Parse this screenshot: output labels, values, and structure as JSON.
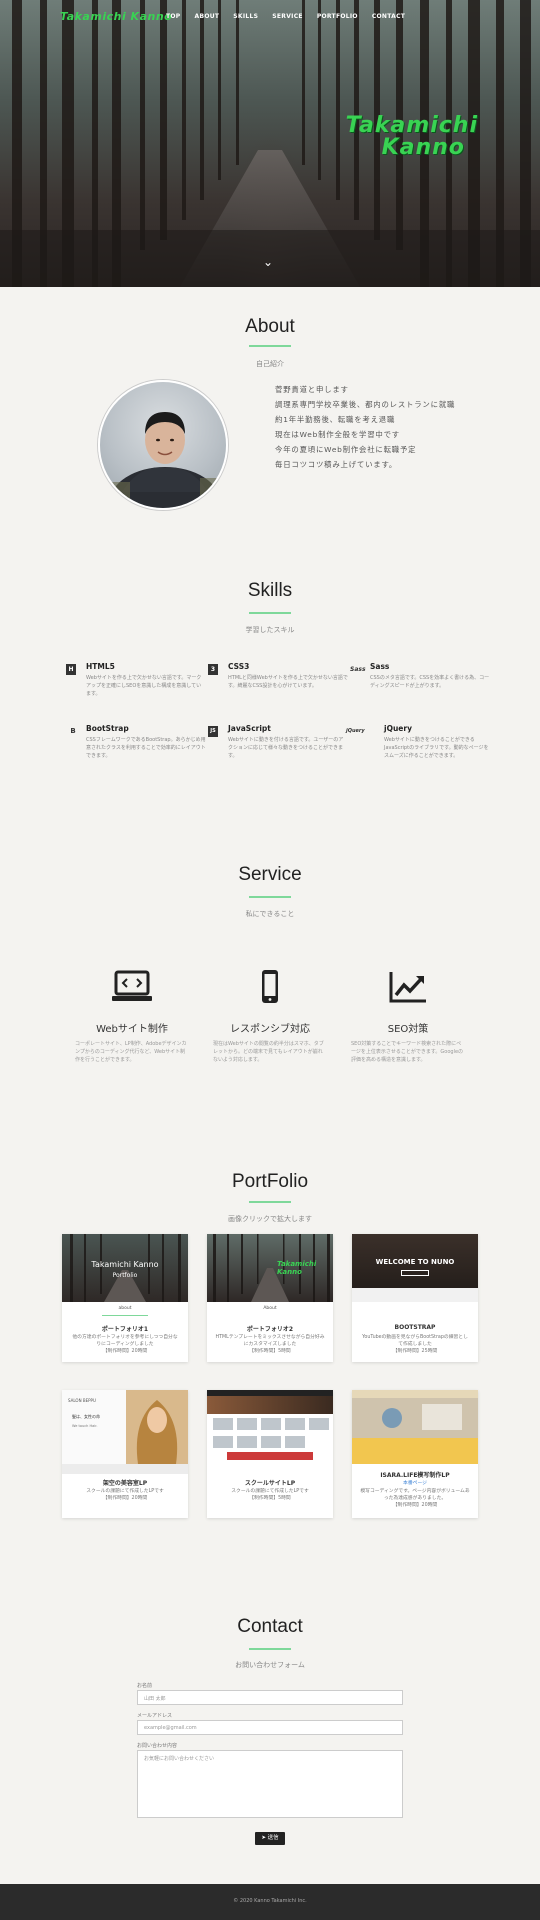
{
  "nav": {
    "logo": "Takamichi Kanno",
    "links": [
      "TOP",
      "ABOUT",
      "SKILLS",
      "SERVICE",
      "PORTFOLIO",
      "CONTACT"
    ]
  },
  "hero": {
    "title_line1": "Takamichi",
    "title_line2": "Kanno",
    "scroll_icon": "chevron-down-icon"
  },
  "about": {
    "title": "About",
    "subtitle": "自己紹介",
    "lines": [
      "菅野貴道と申します",
      "調理系専門学校卒業後、都内のレストランに就職",
      "約1年半勤務後、転職を考え退職",
      "現在はWeb制作全般を学習中です",
      "今年の夏頃にWeb制作会社に転職予定",
      "毎日コツコツ積み上げています。"
    ]
  },
  "skills": {
    "title": "Skills",
    "subtitle": "学習したスキル",
    "items": [
      {
        "name": "HTML5",
        "icon": "H",
        "desc": "Webサイトを作る上で欠かせない言語です。マークアップを正確にしSEOを意識した構成を意識しています。"
      },
      {
        "name": "CSS3",
        "icon": "3",
        "desc": "HTMLと同様Webサイトを作る上で欠かせない言語です。綺麗なCSS設計を心がけています。"
      },
      {
        "name": "Sass",
        "icon": "Sass",
        "desc": "CSSのメタ言語です。CSSを効率よく書ける為、コーディングスピードが上がります。"
      },
      {
        "name": "BootStrap",
        "icon": "B",
        "desc": "CSSフレームワークであるBootStrap。あらかじめ用意されたクラスを利用することで効率的にレイアウトできます。"
      },
      {
        "name": "JavaScript",
        "icon": "JS",
        "desc": "Webサイトに動きを付ける言語です。ユーザーのアクションに応じて様々な動きをつけることができます。"
      },
      {
        "name": "jQuery",
        "icon": "jQuery",
        "desc": "Webサイトに動きをつけることができるJavaScriptのライブラリです。動的なページをスムーズに作ることができます。"
      }
    ]
  },
  "service": {
    "title": "Service",
    "subtitle": "私にできること",
    "items": [
      {
        "title": "Webサイト制作",
        "desc": "コーポレートサイト、LP制作、Adobeデザインカンプからのコーディング代行など、Webサイト制作を行うことができます。"
      },
      {
        "title": "レスポンシブ対応",
        "desc": "現在はWebサイトの閲覧の約半分はスマホ、タブレットから。どの端末で見てもレイアウトが崩れないよう対応します。"
      },
      {
        "title": "SEO対策",
        "desc": "SEO対策することでキーワード検索された際にページを上位表示させることができます。Googleの評価を高める構造を意識します。"
      }
    ]
  },
  "portfolio": {
    "title": "PortFolio",
    "subtitle": "画像クリックで拡大します",
    "items": [
      {
        "title": "ポートフォリオ1",
        "desc": "他の方達のポートフォリオを参考にしつつ自分なりにコーディングしました",
        "time": "【制作時間】20時間"
      },
      {
        "title": "ポートフォリオ2",
        "desc": "HTMLテンプレートをミックスさせながら自分好みにカスタマイズしました",
        "time": "【制作時間】5時間"
      },
      {
        "title": "BOOTSTRAP",
        "desc": "YouTubeの動画を見ながらBootStrapの練習として作成しました",
        "time": "【制作時間】25時間"
      },
      {
        "title": "架空の美容室LP",
        "desc": "スクールの課題にて作成したLPです",
        "time": "【制作時間】20時間"
      },
      {
        "title": "スクールサイトLP",
        "desc": "スクールの課題にて作成したLPです",
        "time": "【制作時間】5時間"
      },
      {
        "title": "ISARA.LIFE模写制作LP",
        "link": "本番ページ",
        "desc": "模写コーディングです。ページ内容がボリュームあった為達成感がありました。",
        "time": "【制作時間】20時間"
      }
    ],
    "thumb1_title": "Takamichi Kanno",
    "thumb1_sub": "Portfolio",
    "thumb1_about": "about",
    "thumb2_title": "Takamichi Kanno",
    "thumb2_about": "About",
    "thumb3_title": "WELCOME TO NUNO",
    "thumb4_brand": "SALON BEPPU",
    "thumb4_line1": "髪は、女性の命",
    "thumb4_line2": "We touch Hair."
  },
  "contact": {
    "title": "Contact",
    "subtitle": "お問い合わせフォーム",
    "name_label": "お名前",
    "name_placeholder": "山田 太郎",
    "email_label": "メールアドレス",
    "email_placeholder": "example@gmail.com",
    "message_label": "お問い合わせ内容",
    "message_placeholder": "お気軽にお問い合わせください",
    "send_label": "送信"
  },
  "footer": {
    "copyright": "© 2020 Kanno Takamichi Inc."
  },
  "colors": {
    "accent": "#39d353",
    "rule": "#7ed89a",
    "footer": "#2b2b2b"
  }
}
